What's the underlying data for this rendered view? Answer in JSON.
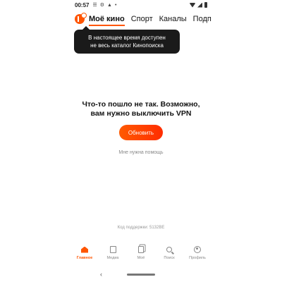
{
  "status_bar": {
    "time": "00:57",
    "icons": [
      "notification-icon",
      "gear-icon",
      "android-icon",
      "dot-icon",
      "wifi-icon",
      "signal-icon",
      "battery-icon"
    ]
  },
  "top_tabs": [
    {
      "label": "Моё кино",
      "active": true
    },
    {
      "label": "Спорт",
      "active": false
    },
    {
      "label": "Каналы",
      "active": false
    },
    {
      "label": "Подписки",
      "active": false
    }
  ],
  "tooltip": {
    "line1": "В настоящее время доступен",
    "line2": "не весь каталог Кинопоиска"
  },
  "error": {
    "line1": "Что-то пошло не так. Возможно,",
    "line2": "вам нужно выключить VPN"
  },
  "retry_label": "Обновить",
  "help_label": "Мне нужна помощь",
  "support_code": "Код поддержки: 5132BE",
  "bottom_nav": [
    {
      "label": "Главное",
      "icon": "home-icon",
      "active": true
    },
    {
      "label": "Медиа",
      "icon": "media-icon",
      "active": false
    },
    {
      "label": "Моё",
      "icon": "bookmark-icon",
      "active": false
    },
    {
      "label": "Поиск",
      "icon": "search-icon",
      "active": false
    },
    {
      "label": "Профиль",
      "icon": "profile-icon",
      "active": false
    }
  ],
  "colors": {
    "accent": "#ff5500",
    "tooltip_bg": "#1a1a1a",
    "muted": "#888888"
  }
}
